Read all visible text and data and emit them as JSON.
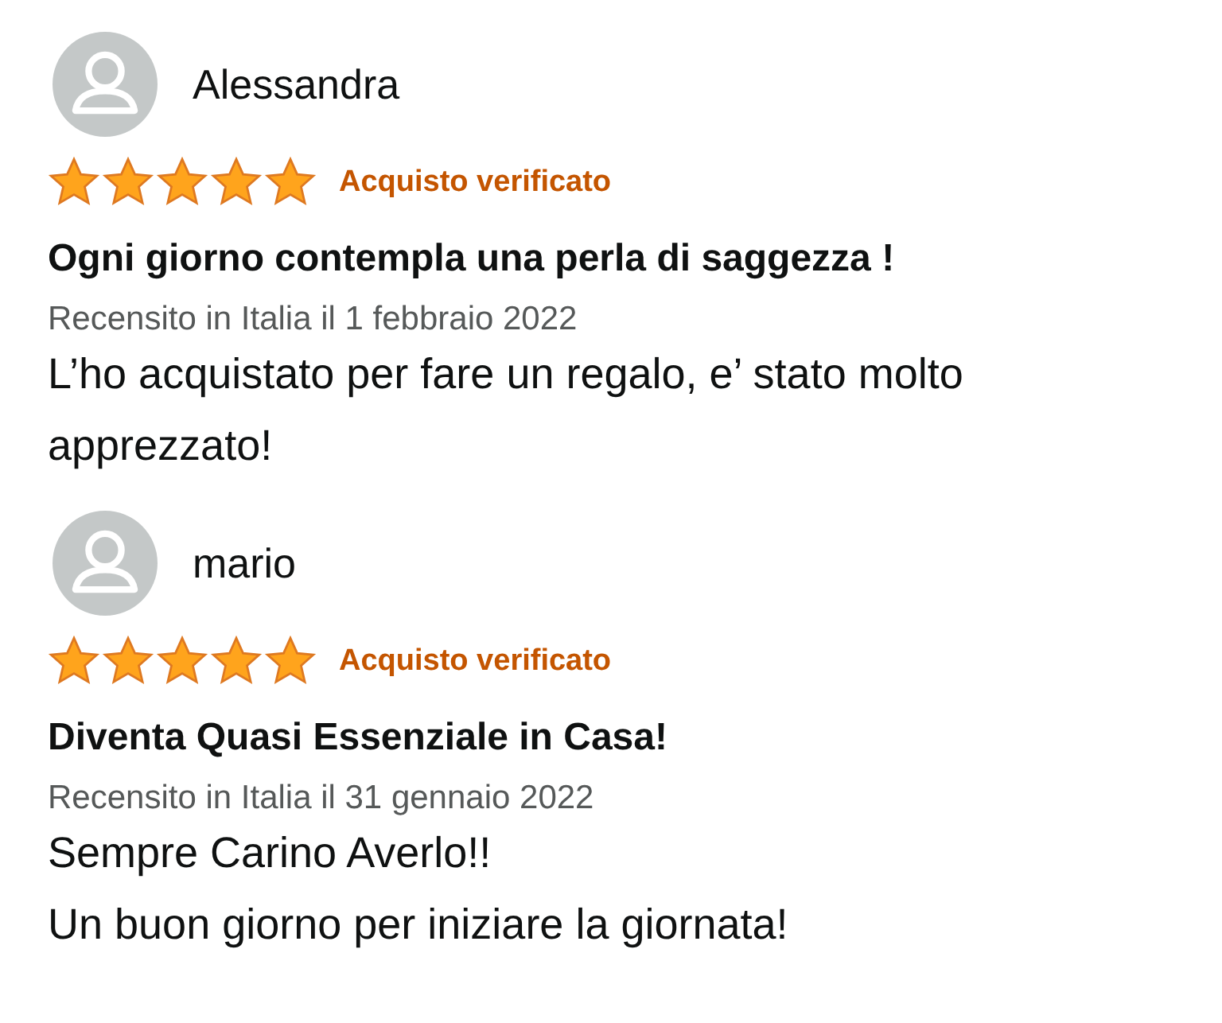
{
  "reviews": [
    {
      "author": "Alessandra",
      "stars": 5,
      "badge": "Acquisto verificato",
      "title": "Ogni giorno contempla una perla di saggezza !",
      "date": "Recensito in Italia il 1 febbraio 2022",
      "body": [
        "L’ho acquistato per fare un regalo, e’ stato molto apprezzato!"
      ]
    },
    {
      "author": "mario",
      "stars": 5,
      "badge": "Acquisto verificato",
      "title": "Diventa Quasi Essenziale in Casa!",
      "date": "Recensito in Italia il 31 gennaio 2022",
      "body": [
        "Sempre Carino Averlo!!",
        "Un buon giorno per iniziare la giornata!"
      ]
    }
  ]
}
